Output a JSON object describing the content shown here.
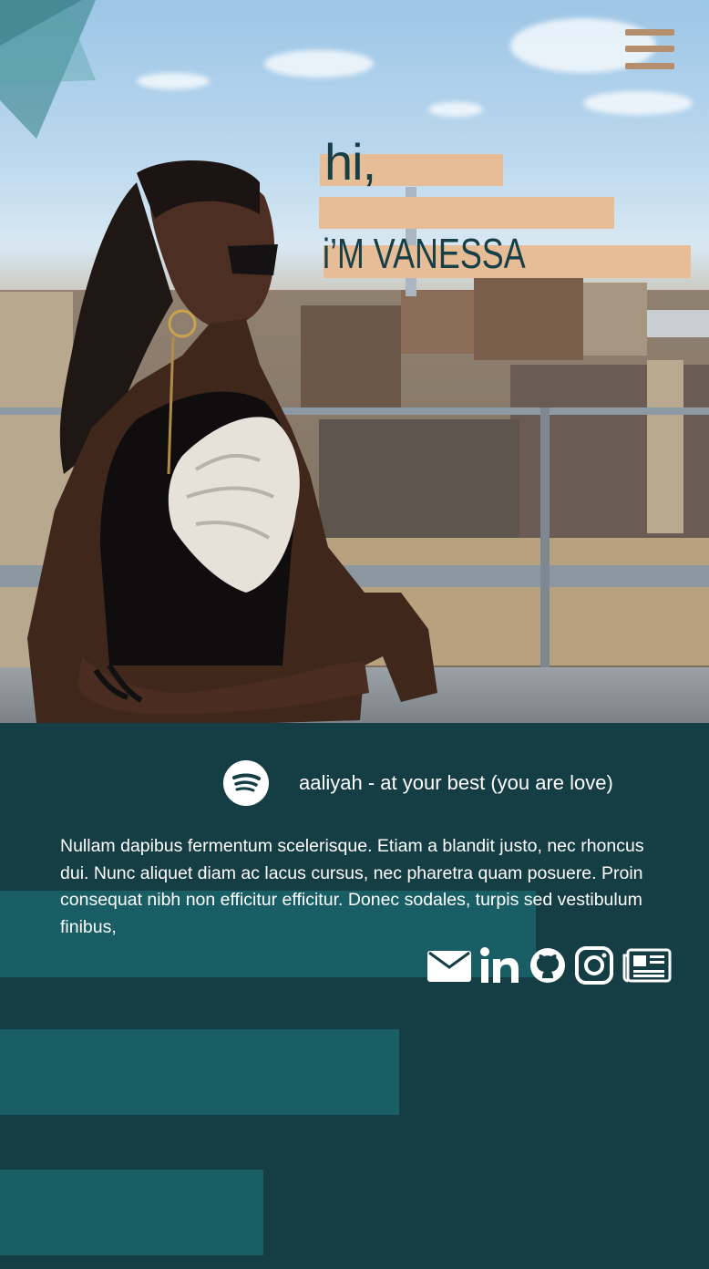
{
  "hero": {
    "greeting": "hi,",
    "name": "i’M VANESSA"
  },
  "now_playing": {
    "track": "aaliyah - at your best (you are love)"
  },
  "bio": {
    "text": "Nullam dapibus fermentum scelerisque. Etiam a blandit justo, nec rhoncus dui. Nunc aliquet diam ac lacus cursus, nec pharetra quam posuere. Proin consequat nibh non efficitur efficitur. Donec sodales, turpis sed vestibulum finibus,"
  },
  "socials": [
    {
      "icon": "envelope-icon"
    },
    {
      "icon": "linkedin-icon"
    },
    {
      "icon": "github-icon"
    },
    {
      "icon": "instagram-icon"
    },
    {
      "icon": "newspaper-icon"
    }
  ],
  "colors": {
    "background": "#153d44",
    "bar": "#1a5e65",
    "highlight": "#e6bd97",
    "menu": "#b58e6e",
    "heading": "#173f47"
  }
}
